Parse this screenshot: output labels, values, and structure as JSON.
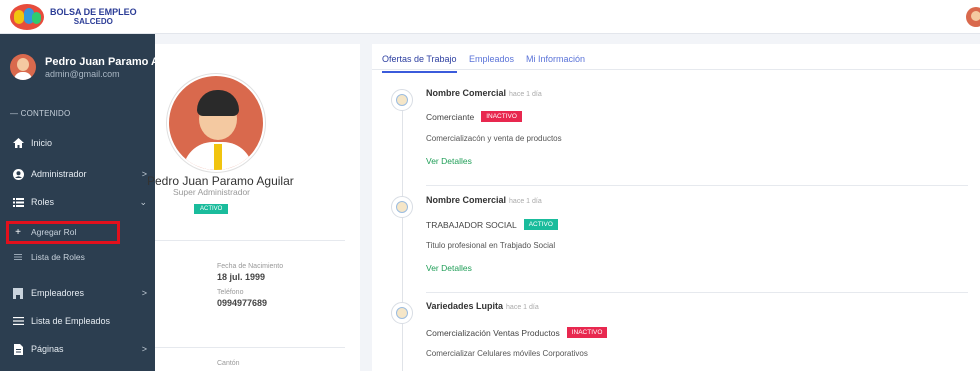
{
  "app": {
    "logo_line1": "BOLSA DE EMPLEO",
    "logo_line2": "SALCEDO"
  },
  "sidebar": {
    "user_name": "Pedro Juan Paramo A...",
    "user_email": "admin@gmail.com",
    "section_label": "— CONTENIDO",
    "items": [
      {
        "label": "Inicio",
        "icon": "home-icon"
      },
      {
        "label": "Administrador",
        "icon": "user-circle-icon"
      },
      {
        "label": "Roles",
        "icon": "list-icon"
      },
      {
        "label": "Agregar Rol",
        "icon": "plus-icon"
      },
      {
        "label": "Lista de Roles",
        "icon": "list-icon"
      },
      {
        "label": "Empleadores",
        "icon": "building-icon"
      },
      {
        "label": "Lista de Empleados",
        "icon": "list-icon"
      },
      {
        "label": "Páginas",
        "icon": "file-icon"
      }
    ]
  },
  "profile": {
    "name": "Pedro Juan Paramo Aguilar",
    "role": "Super Administrador",
    "status": "ACTIVO",
    "birth_label": "Fecha de Nacimiento",
    "birth_value": "18 jul. 1999",
    "phone_label": "Teléfono",
    "phone_value": "0994977689",
    "canton_label": "Cantón"
  },
  "tabs": [
    "Ofertas de Trabajo",
    "Empleados",
    "Mi Información"
  ],
  "offers": [
    {
      "company": "Nombre Comercial",
      "time": "hace 1 día",
      "position": "Comerciante",
      "status": "INACTIVO",
      "description": "Comercializacón y venta de productos",
      "link": "Ver Detalles"
    },
    {
      "company": "Nombre Comercial",
      "time": "hace 1 día",
      "position": "TRABAJADOR SOCIAL",
      "status": "ACTIVO",
      "description": "Titulo profesional en Trabjado Social",
      "link": "Ver Detalles"
    },
    {
      "company": "Variedades Lupita",
      "time": "hace 1 día",
      "position": "Comercialización Ventas Productos",
      "status": "INACTIVO",
      "description": "Comercializar Celulares móviles Corporativos"
    }
  ],
  "colors": {
    "sidebar_bg": "#2c3e50",
    "active_badge": "#1abc9c",
    "inactive_badge": "#e8284f",
    "link": "#1f9e57",
    "highlight_border": "#e3101c"
  }
}
